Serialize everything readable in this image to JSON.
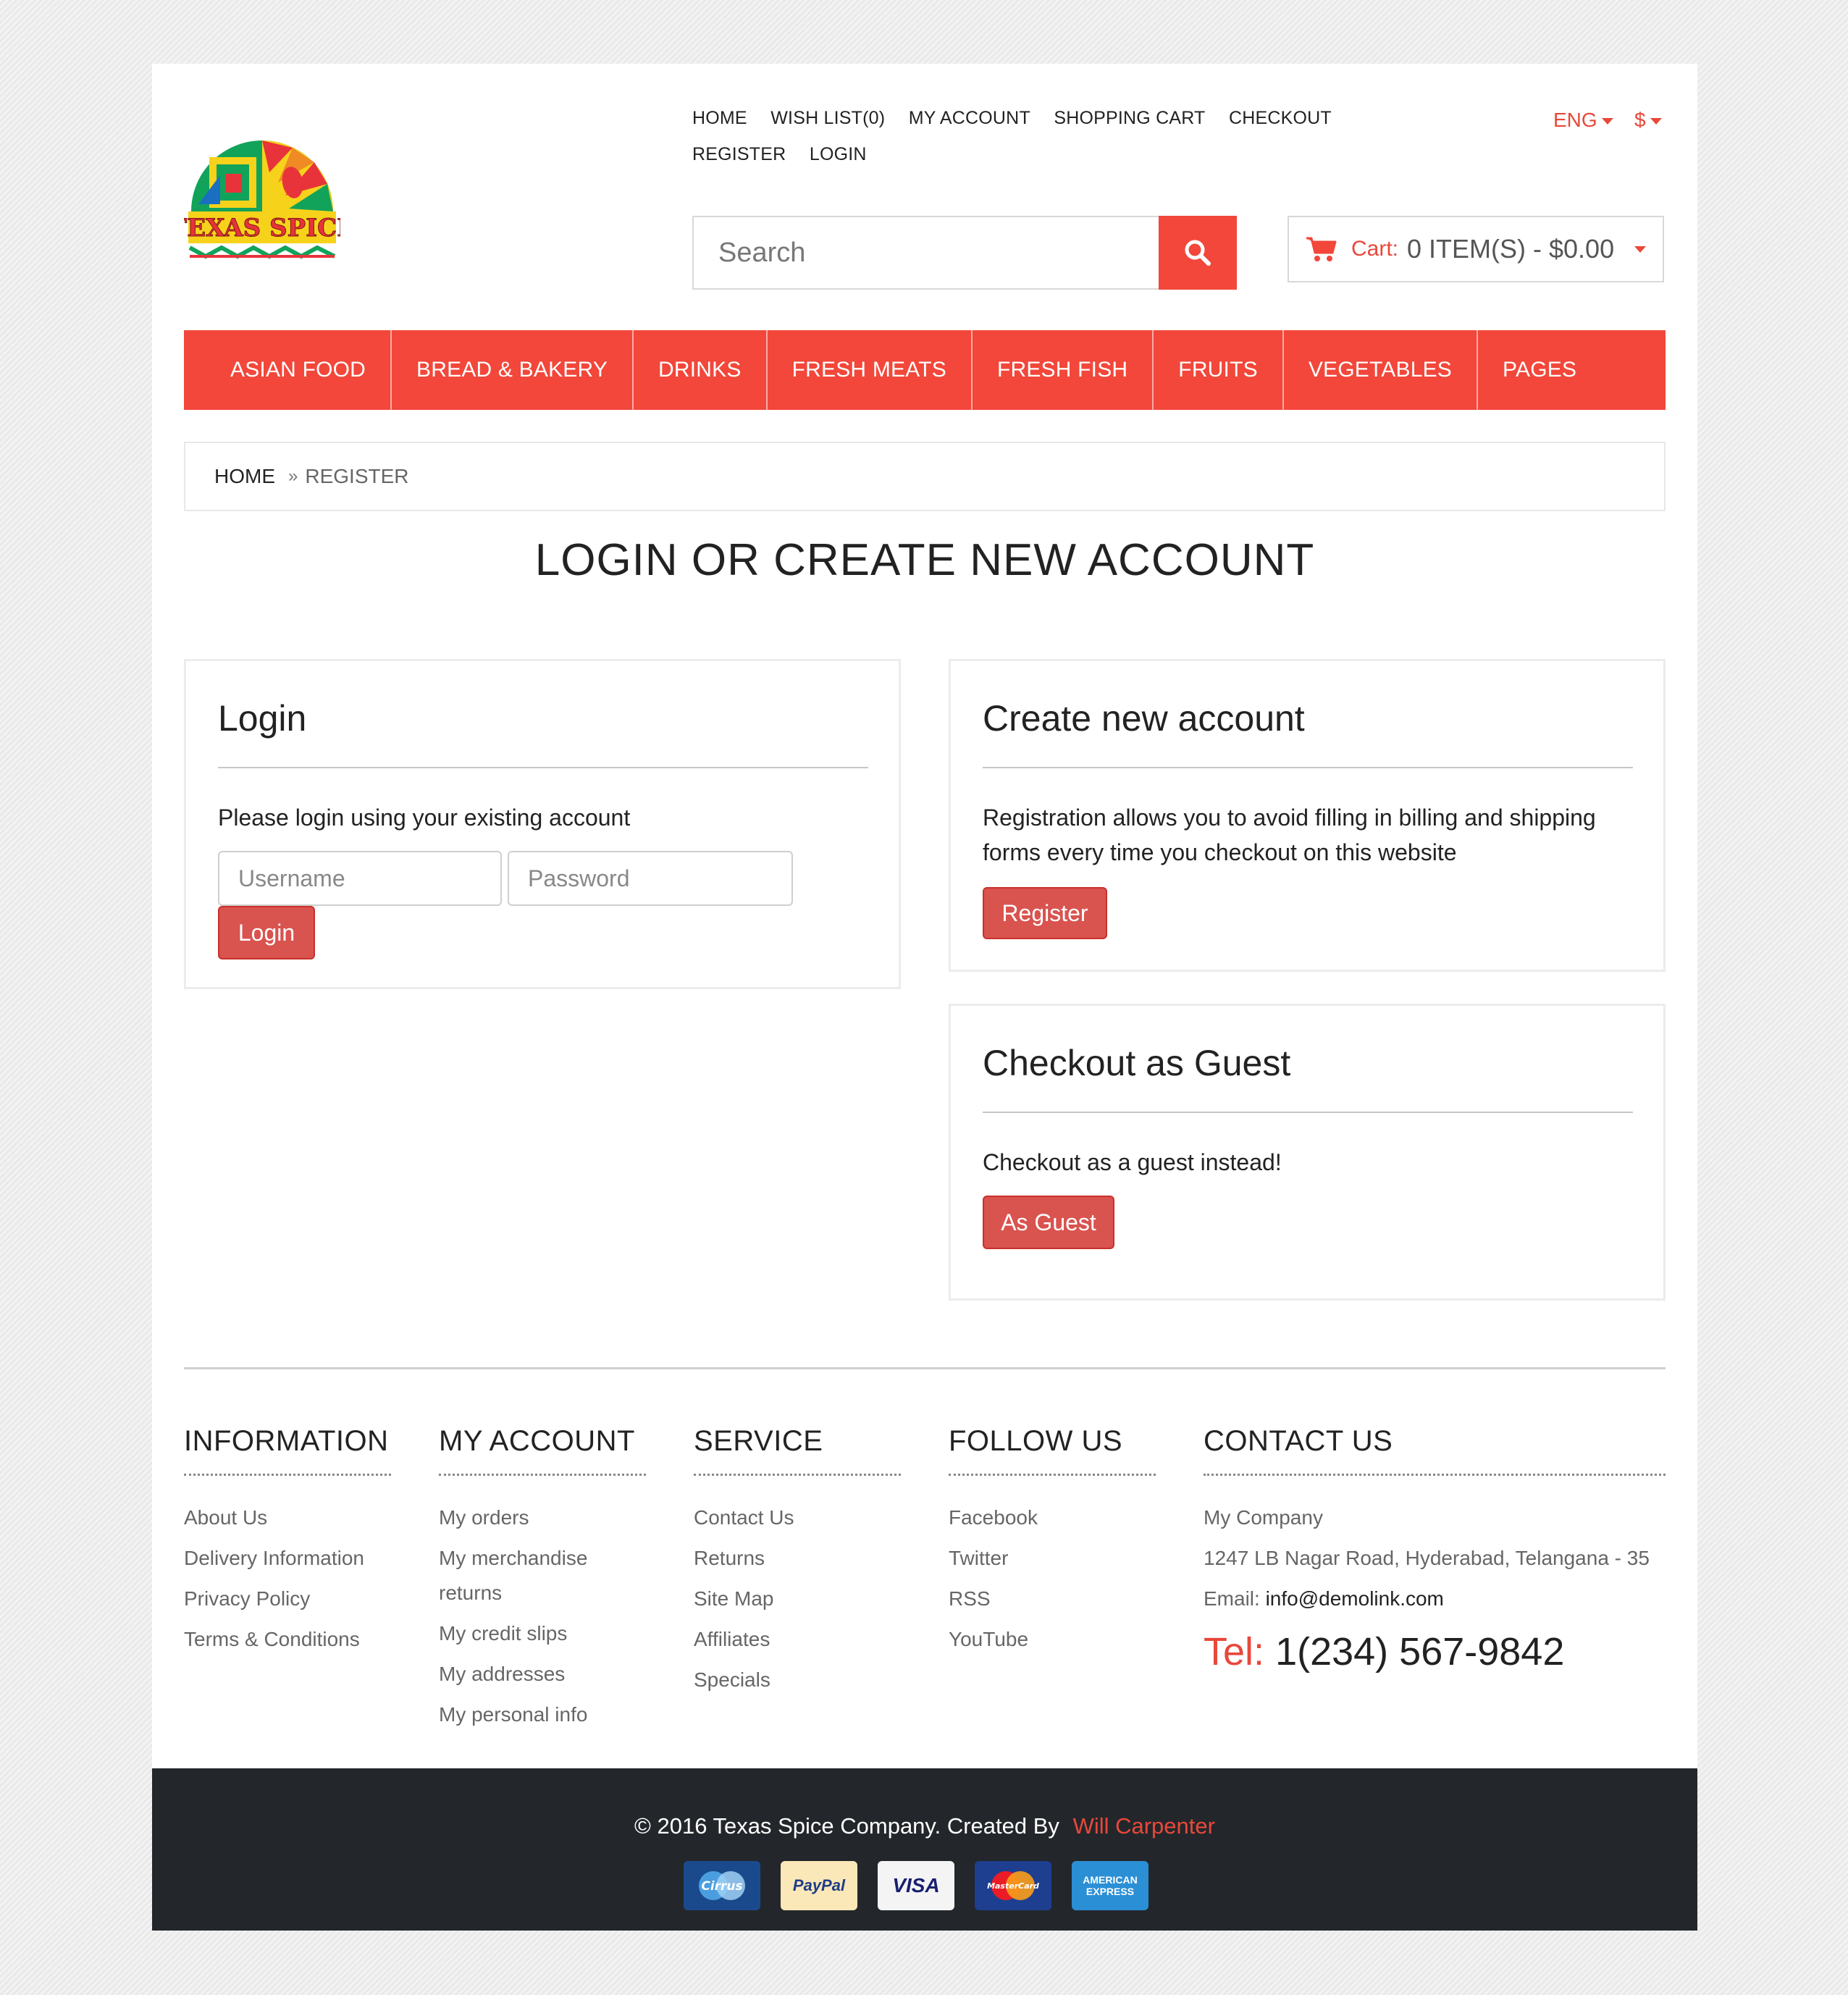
{
  "brand": {
    "logo_text": "TEXAS SPICE"
  },
  "top_links": [
    "HOME",
    "WISH LIST(0)",
    "MY ACCOUNT",
    "SHOPPING CART",
    "CHECKOUT",
    "REGISTER",
    "LOGIN"
  ],
  "language": "ENG",
  "currency": "$",
  "search": {
    "placeholder": "Search"
  },
  "cart": {
    "label": "Cart:",
    "summary": "0 ITEM(S) - $0.00"
  },
  "nav": [
    "ASIAN FOOD",
    "BREAD & BAKERY",
    "DRINKS",
    "FRESH MEATS",
    "FRESH FISH",
    "FRUITS",
    "VEGETABLES",
    "PAGES"
  ],
  "breadcrumb": {
    "home": "HOME",
    "separator": "»",
    "current": "REGISTER"
  },
  "page_title": "LOGIN OR CREATE NEW ACCOUNT",
  "login": {
    "title": "Login",
    "text": "Please login using your existing account",
    "username_placeholder": "Username",
    "password_placeholder": "Password",
    "button": "Login"
  },
  "register": {
    "title": "Create new account",
    "text": "Registration allows you to avoid filling in billing and shipping forms every time you checkout on this website",
    "button": "Register"
  },
  "guest": {
    "title": "Checkout as Guest",
    "text": "Checkout as a guest instead!",
    "button": "As Guest"
  },
  "footer": {
    "information": {
      "title": "INFORMATION",
      "links": [
        "About Us",
        "Delivery Information",
        "Privacy Policy",
        "Terms & Conditions"
      ]
    },
    "my_account": {
      "title": "MY ACCOUNT",
      "links": [
        "My orders",
        "My merchandise returns",
        "My credit slips",
        "My addresses",
        "My personal info"
      ]
    },
    "service": {
      "title": "SERVICE",
      "links": [
        "Contact Us",
        "Returns",
        "Site Map",
        "Affiliates",
        "Specials"
      ]
    },
    "follow_us": {
      "title": "FOLLOW US",
      "links": [
        "Facebook",
        "Twitter",
        "RSS",
        "YouTube"
      ]
    },
    "contact_us": {
      "title": "CONTACT US",
      "company": "My Company",
      "address": "1247 LB Nagar Road, Hyderabad, Telangana - 35",
      "email_label": "Email:",
      "email": "info@demolink.com",
      "tel_label": "Tel:",
      "tel": "1(234) 567-9842"
    }
  },
  "copyright": {
    "text": "© 2016 Texas Spice Company. Created By",
    "author": "Will Carpenter"
  },
  "payment_cards": [
    "Cirrus",
    "PayPal",
    "VISA",
    "MasterCard",
    "AMERICAN EXPRESS"
  ],
  "colors": {
    "accent": "#f2473a",
    "button": "#d9534f",
    "footer_bg": "#23272b"
  }
}
